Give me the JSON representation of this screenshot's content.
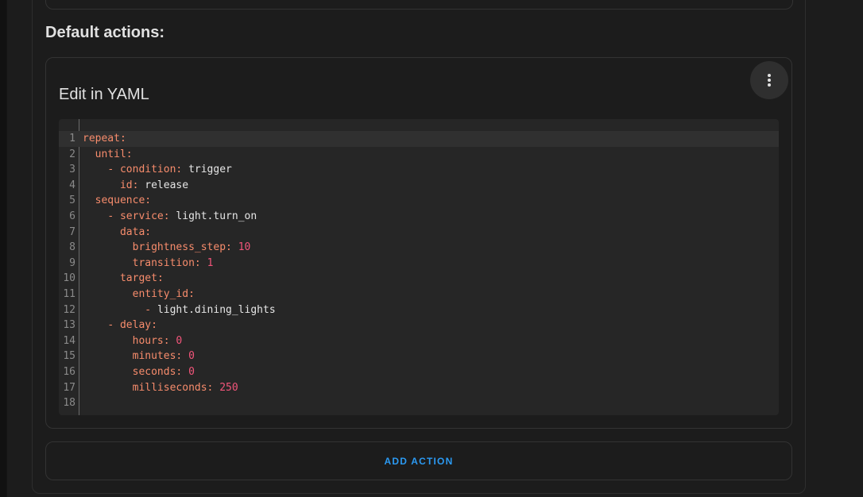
{
  "section": {
    "title": "Default actions:"
  },
  "yaml_card": {
    "title": "Edit in YAML",
    "menu_icon": "dots-vertical-icon"
  },
  "editor": {
    "active_line": 1,
    "lines": [
      {
        "n": "1",
        "indent": "",
        "dash": "",
        "key": "repeat",
        "value": "",
        "value_type": ""
      },
      {
        "n": "2",
        "indent": "  ",
        "dash": "",
        "key": "until",
        "value": "",
        "value_type": ""
      },
      {
        "n": "3",
        "indent": "    ",
        "dash": "- ",
        "key": "condition",
        "value": "trigger",
        "value_type": "str"
      },
      {
        "n": "4",
        "indent": "      ",
        "dash": "",
        "key": "id",
        "value": "release",
        "value_type": "str"
      },
      {
        "n": "5",
        "indent": "  ",
        "dash": "",
        "key": "sequence",
        "value": "",
        "value_type": ""
      },
      {
        "n": "6",
        "indent": "    ",
        "dash": "- ",
        "key": "service",
        "value": "light.turn_on",
        "value_type": "str"
      },
      {
        "n": "7",
        "indent": "      ",
        "dash": "",
        "key": "data",
        "value": "",
        "value_type": ""
      },
      {
        "n": "8",
        "indent": "        ",
        "dash": "",
        "key": "brightness_step",
        "value": "10",
        "value_type": "num"
      },
      {
        "n": "9",
        "indent": "        ",
        "dash": "",
        "key": "transition",
        "value": "1",
        "value_type": "num"
      },
      {
        "n": "10",
        "indent": "      ",
        "dash": "",
        "key": "target",
        "value": "",
        "value_type": ""
      },
      {
        "n": "11",
        "indent": "        ",
        "dash": "",
        "key": "entity_id",
        "value": "",
        "value_type": ""
      },
      {
        "n": "12",
        "indent": "          ",
        "dash": "- ",
        "key": "",
        "value": "light.dining_lights",
        "value_type": "str"
      },
      {
        "n": "13",
        "indent": "    ",
        "dash": "- ",
        "key": "delay",
        "value": "",
        "value_type": ""
      },
      {
        "n": "14",
        "indent": "        ",
        "dash": "",
        "key": "hours",
        "value": "0",
        "value_type": "num"
      },
      {
        "n": "15",
        "indent": "        ",
        "dash": "",
        "key": "minutes",
        "value": "0",
        "value_type": "num"
      },
      {
        "n": "16",
        "indent": "        ",
        "dash": "",
        "key": "seconds",
        "value": "0",
        "value_type": "num"
      },
      {
        "n": "17",
        "indent": "        ",
        "dash": "",
        "key": "milliseconds",
        "value": "250",
        "value_type": "num"
      },
      {
        "n": "18",
        "indent": "",
        "dash": "",
        "key": "",
        "value": "",
        "value_type": ""
      }
    ]
  },
  "actions": {
    "add_action_label": "ADD ACTION"
  },
  "colors": {
    "accent": "#2b9af3",
    "yaml_key": "#f78c6c",
    "yaml_number": "#f2557a",
    "yaml_string": "#e6e6e6",
    "background": "#1c1c1c"
  }
}
